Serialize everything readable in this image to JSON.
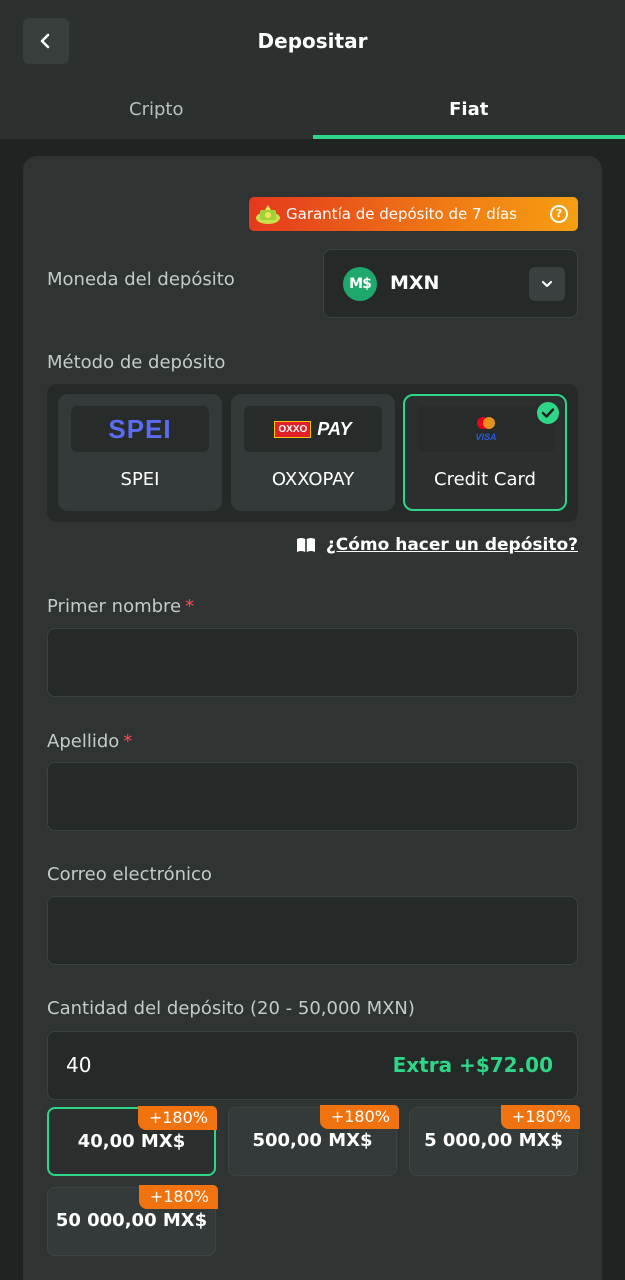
{
  "header": {
    "title": "Depositar",
    "back_icon": "chevron-left-icon"
  },
  "tabs": [
    {
      "label": "Cripto",
      "active": false
    },
    {
      "label": "Fiat",
      "active": true
    }
  ],
  "guarantee": {
    "text": "Garantía de depósito de 7 días",
    "help": "?"
  },
  "currency": {
    "label": "Moneda del depósito",
    "coin_symbol": "M$",
    "code": "MXN"
  },
  "method": {
    "label": "Método de depósito",
    "options": [
      {
        "name": "SPEI",
        "logo_text": "SPEI",
        "selected": false
      },
      {
        "name": "OXXOPAY",
        "logo_box": "OXXO",
        "logo_text": "PAY",
        "selected": false
      },
      {
        "name": "Credit Card",
        "logo_text": "VISA",
        "selected": true
      }
    ]
  },
  "howto": {
    "text": "¿Cómo hacer un depósito?"
  },
  "form": {
    "first_name": {
      "label": "Primer nombre",
      "required": "*",
      "value": ""
    },
    "last_name": {
      "label": "Apellido",
      "required": "*",
      "value": ""
    },
    "email": {
      "label": "Correo electrónico",
      "value": ""
    }
  },
  "amount": {
    "label": "Cantidad del depósito (20 - 50,000 MXN)",
    "value": "40",
    "extra": "Extra +$72.00",
    "presets": [
      {
        "value": "40,00 MX$",
        "badge": "+180%",
        "selected": true
      },
      {
        "value": "500,00 MX$",
        "badge": "+180%",
        "selected": false
      },
      {
        "value": "5 000,00 MX$",
        "badge": "+180%",
        "selected": false
      },
      {
        "value": "50 000,00 MX$",
        "badge": "+180%",
        "selected": false
      }
    ]
  },
  "colors": {
    "accent": "#2ed688",
    "badge": "#f0730f",
    "danger": "#ff4a55"
  }
}
